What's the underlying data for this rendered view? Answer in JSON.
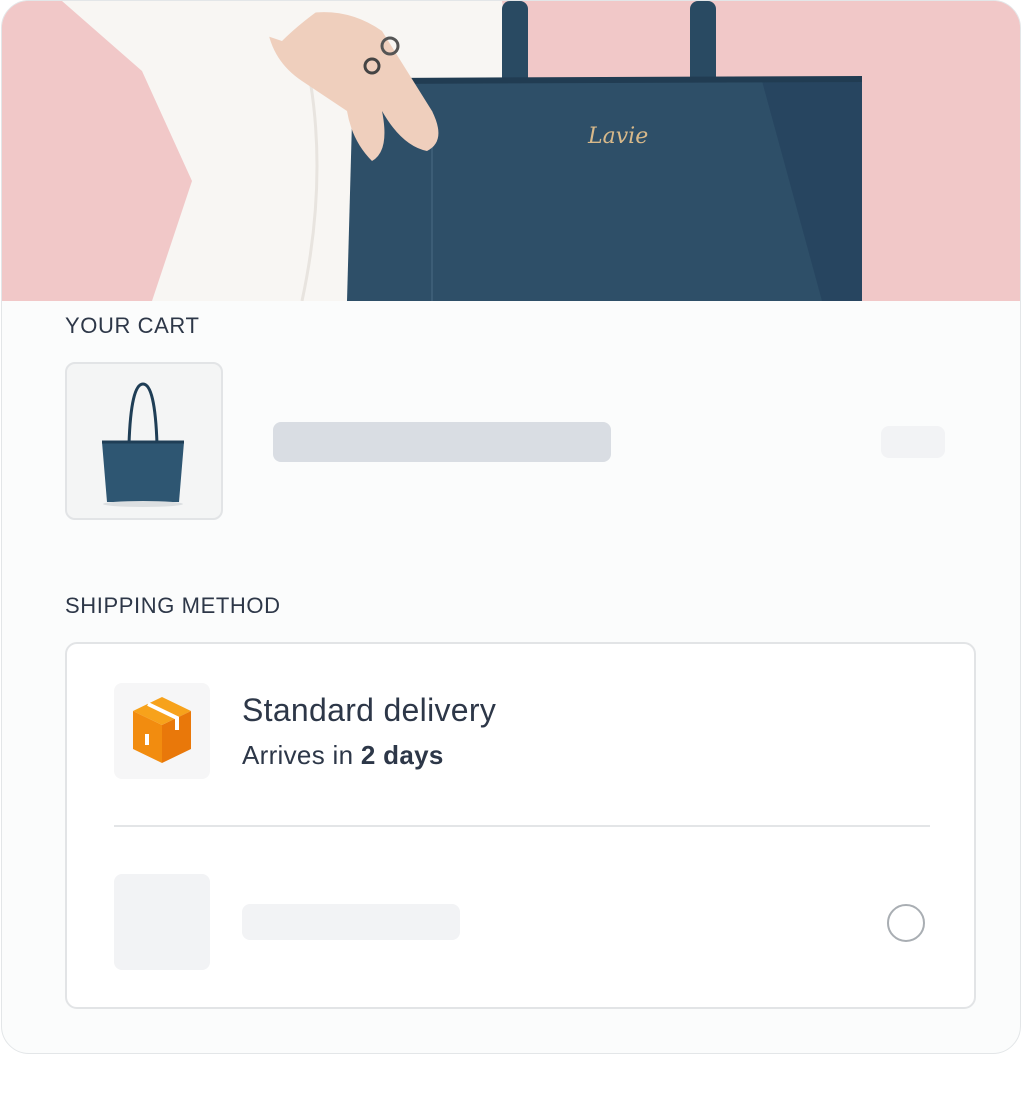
{
  "cart": {
    "heading": "YOUR CART",
    "product_image": "tote-bag-thumbnail"
  },
  "shipping": {
    "heading": "SHIPPING METHOD",
    "options": [
      {
        "title": "Standard delivery",
        "subtitle_prefix": "Arrives in",
        "subtitle_bold": "2 days",
        "icon": "package-box-icon",
        "selected": false
      }
    ]
  },
  "colors": {
    "hero_bg": "#f1c8c8",
    "bag": "#2e4f68",
    "box_icon": "#f28c0f",
    "skeleton": "#d9dde3",
    "skeleton_light": "#f2f3f5"
  }
}
